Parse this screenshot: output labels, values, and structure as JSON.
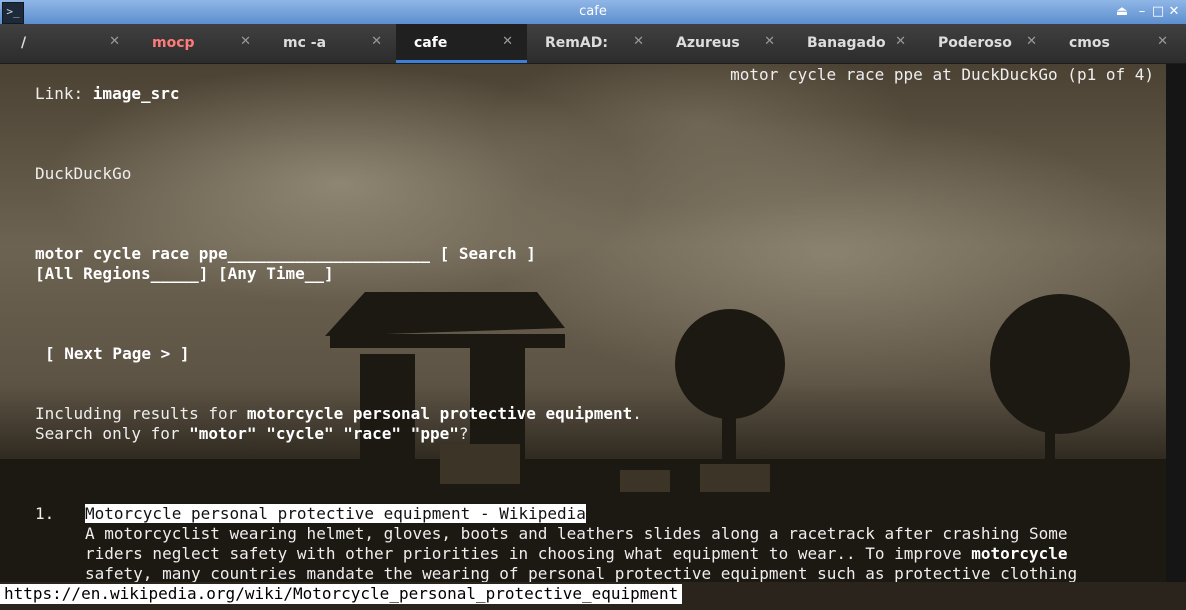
{
  "window": {
    "title": "cafe"
  },
  "tabs": [
    {
      "label": "/",
      "active": false,
      "alert": false
    },
    {
      "label": "mocp",
      "active": false,
      "alert": true
    },
    {
      "label": "mc -a",
      "active": false,
      "alert": false
    },
    {
      "label": "cafe",
      "active": true,
      "alert": false
    },
    {
      "label": "RemAD:",
      "active": false,
      "alert": false
    },
    {
      "label": "Azureus",
      "active": false,
      "alert": false
    },
    {
      "label": "Banagado",
      "active": false,
      "alert": false
    },
    {
      "label": "Poderoso",
      "active": false,
      "alert": false
    },
    {
      "label": "cmos",
      "active": false,
      "alert": false
    }
  ],
  "page": {
    "header": "motor cycle race ppe at DuckDuckGo (p1 of 4)",
    "link_prefix": "Link: ",
    "link_value": "image_src",
    "site_name": "DuckDuckGo",
    "search_field": "motor cycle race ppe_____________________",
    "search_button": "[ Search ]",
    "region_select": "[All Regions_____]",
    "time_select": "[Any Time__]",
    "next_page": "[ Next Page > ]",
    "including_prefix": "Including results for ",
    "including_term": "motorcycle personal protective equipment",
    "including_suffix": ".",
    "search_only_prefix": "Search only for ",
    "search_only_terms": "\"motor\" \"cycle\" \"race\" \"ppe\"",
    "search_only_suffix": "?",
    "result1": {
      "number": "1.",
      "title": "Motorcycle personal protective equipment - Wikipedia",
      "line1": "A motorcyclist wearing helmet, gloves, boots and leathers slides along a racetrack after crashing Some",
      "line2_a": "riders neglect safety with other priorities in choosing what equipment to wear.. To improve ",
      "line2_b": "motorcycle",
      "line3": "safety, many countries mandate the wearing of personal protective equipment such as protective clothing"
    }
  },
  "status_url": "https://en.wikipedia.org/wiki/Motorcycle_personal_protective_equipment"
}
